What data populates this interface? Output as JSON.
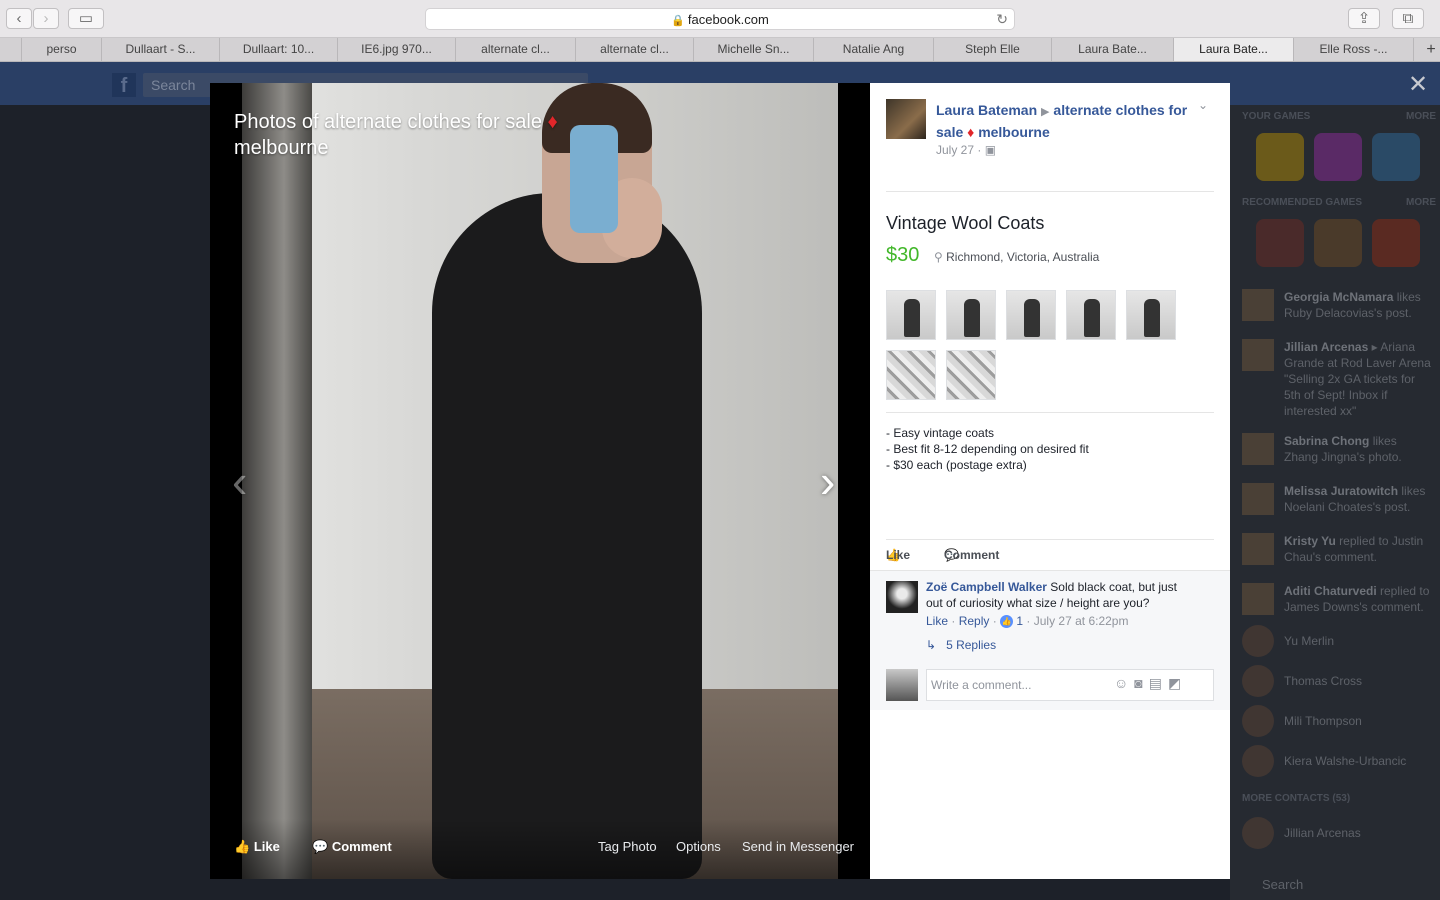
{
  "browser": {
    "url": "facebook.com",
    "tabs": [
      "perso",
      "Dullaart - S...",
      "Dullaart: 10...",
      "IE6.jpg 970...",
      "alternate cl...",
      "alternate cl...",
      "Michelle Sn...",
      "Natalie Ang",
      "Steph Elle",
      "Laura Bate...",
      "Laura Bate...",
      "Elle Ross -..."
    ],
    "active_tab_index": 10,
    "new_tab_label": "+"
  },
  "fb": {
    "logo": "f",
    "search_placeholder": "Search"
  },
  "viewer": {
    "album_title": "Photos of alternate clothes for sale",
    "album_title_diamond": "♦",
    "album_title_city": "melbourne",
    "actions": {
      "like": "Like",
      "comment": "Comment",
      "tag": "Tag Photo",
      "options": "Options",
      "send": "Send in Messenger"
    },
    "close": "✕"
  },
  "post": {
    "author": "Laura Bateman",
    "group_name": "alternate clothes for sale",
    "group_diamond": "♦",
    "group_city": "melbourne",
    "date": "July 27 ·",
    "item_title": "Vintage Wool Coats",
    "price": "$30",
    "location": "Richmond, Victoria, Australia",
    "description": [
      "- Easy vintage coats",
      "- Best fit 8-12 depending on desired fit",
      "- $30 each (postage extra)"
    ],
    "like_label": "Like",
    "comment_label": "Comment"
  },
  "comment": {
    "name": "Zoë Campbell Walker",
    "text": "Sold black coat, but just out of curiosity what size / height are you?",
    "like": "Like",
    "reply": "Reply",
    "like_count": "1",
    "time": "July 27 at 6:22pm",
    "replies": "5 Replies",
    "input_placeholder": "Write a comment..."
  },
  "sidebar": {
    "your_games": "YOUR GAMES",
    "more": "MORE",
    "recommended": "RECOMMENDED GAMES",
    "activity": [
      {
        "name": "Georgia McNamara",
        "text": "likes Ruby Delacovias's post."
      },
      {
        "name": "Jillian Arcenas",
        "text": "▸ Ariana Grande at Rod Laver Arena \"Selling 2x GA tickets for 5th of Sept! Inbox if interested xx\""
      },
      {
        "name": "Sabrina Chong",
        "text": "likes Zhang Jingna's photo."
      },
      {
        "name": "Melissa Juratowitch",
        "text": "likes Noelani Choates's post."
      },
      {
        "name": "Kristy Yu",
        "text": "replied to Justin Chau's comment."
      },
      {
        "name": "Aditi Chaturvedi",
        "text": "replied to James Downs's comment."
      }
    ],
    "contacts": [
      "Yu Merlin",
      "Thomas Cross",
      "Mili Thompson",
      "Kiera Walshe-Urbancic"
    ],
    "more_contacts": "MORE CONTACTS (53)",
    "more_contact_1": "Jillian Arcenas",
    "search": "Search"
  }
}
